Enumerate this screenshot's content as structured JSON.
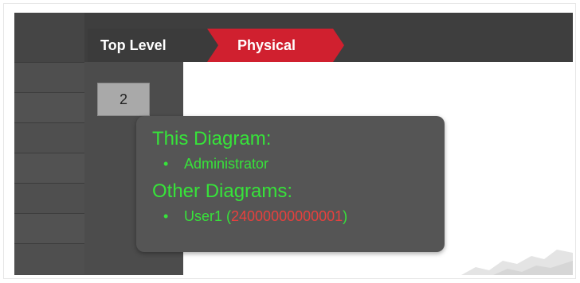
{
  "breadcrumb": {
    "items": [
      {
        "label": "Top Level",
        "active": false
      },
      {
        "label": "Physical",
        "active": true
      }
    ]
  },
  "badge": {
    "value": "2"
  },
  "tooltip": {
    "this_diagram_heading": "This Diagram:",
    "this_diagram_items": [
      "Administrator"
    ],
    "other_diagrams_heading": "Other Diagrams:",
    "other_diagrams_items": [
      {
        "name": "User1",
        "id": "24000000000001"
      }
    ]
  },
  "colors": {
    "accent_red": "#d0202f",
    "tooltip_text_green": "#37e33a",
    "id_red": "#e8403d",
    "panel_dark": "#4a4a4a"
  }
}
